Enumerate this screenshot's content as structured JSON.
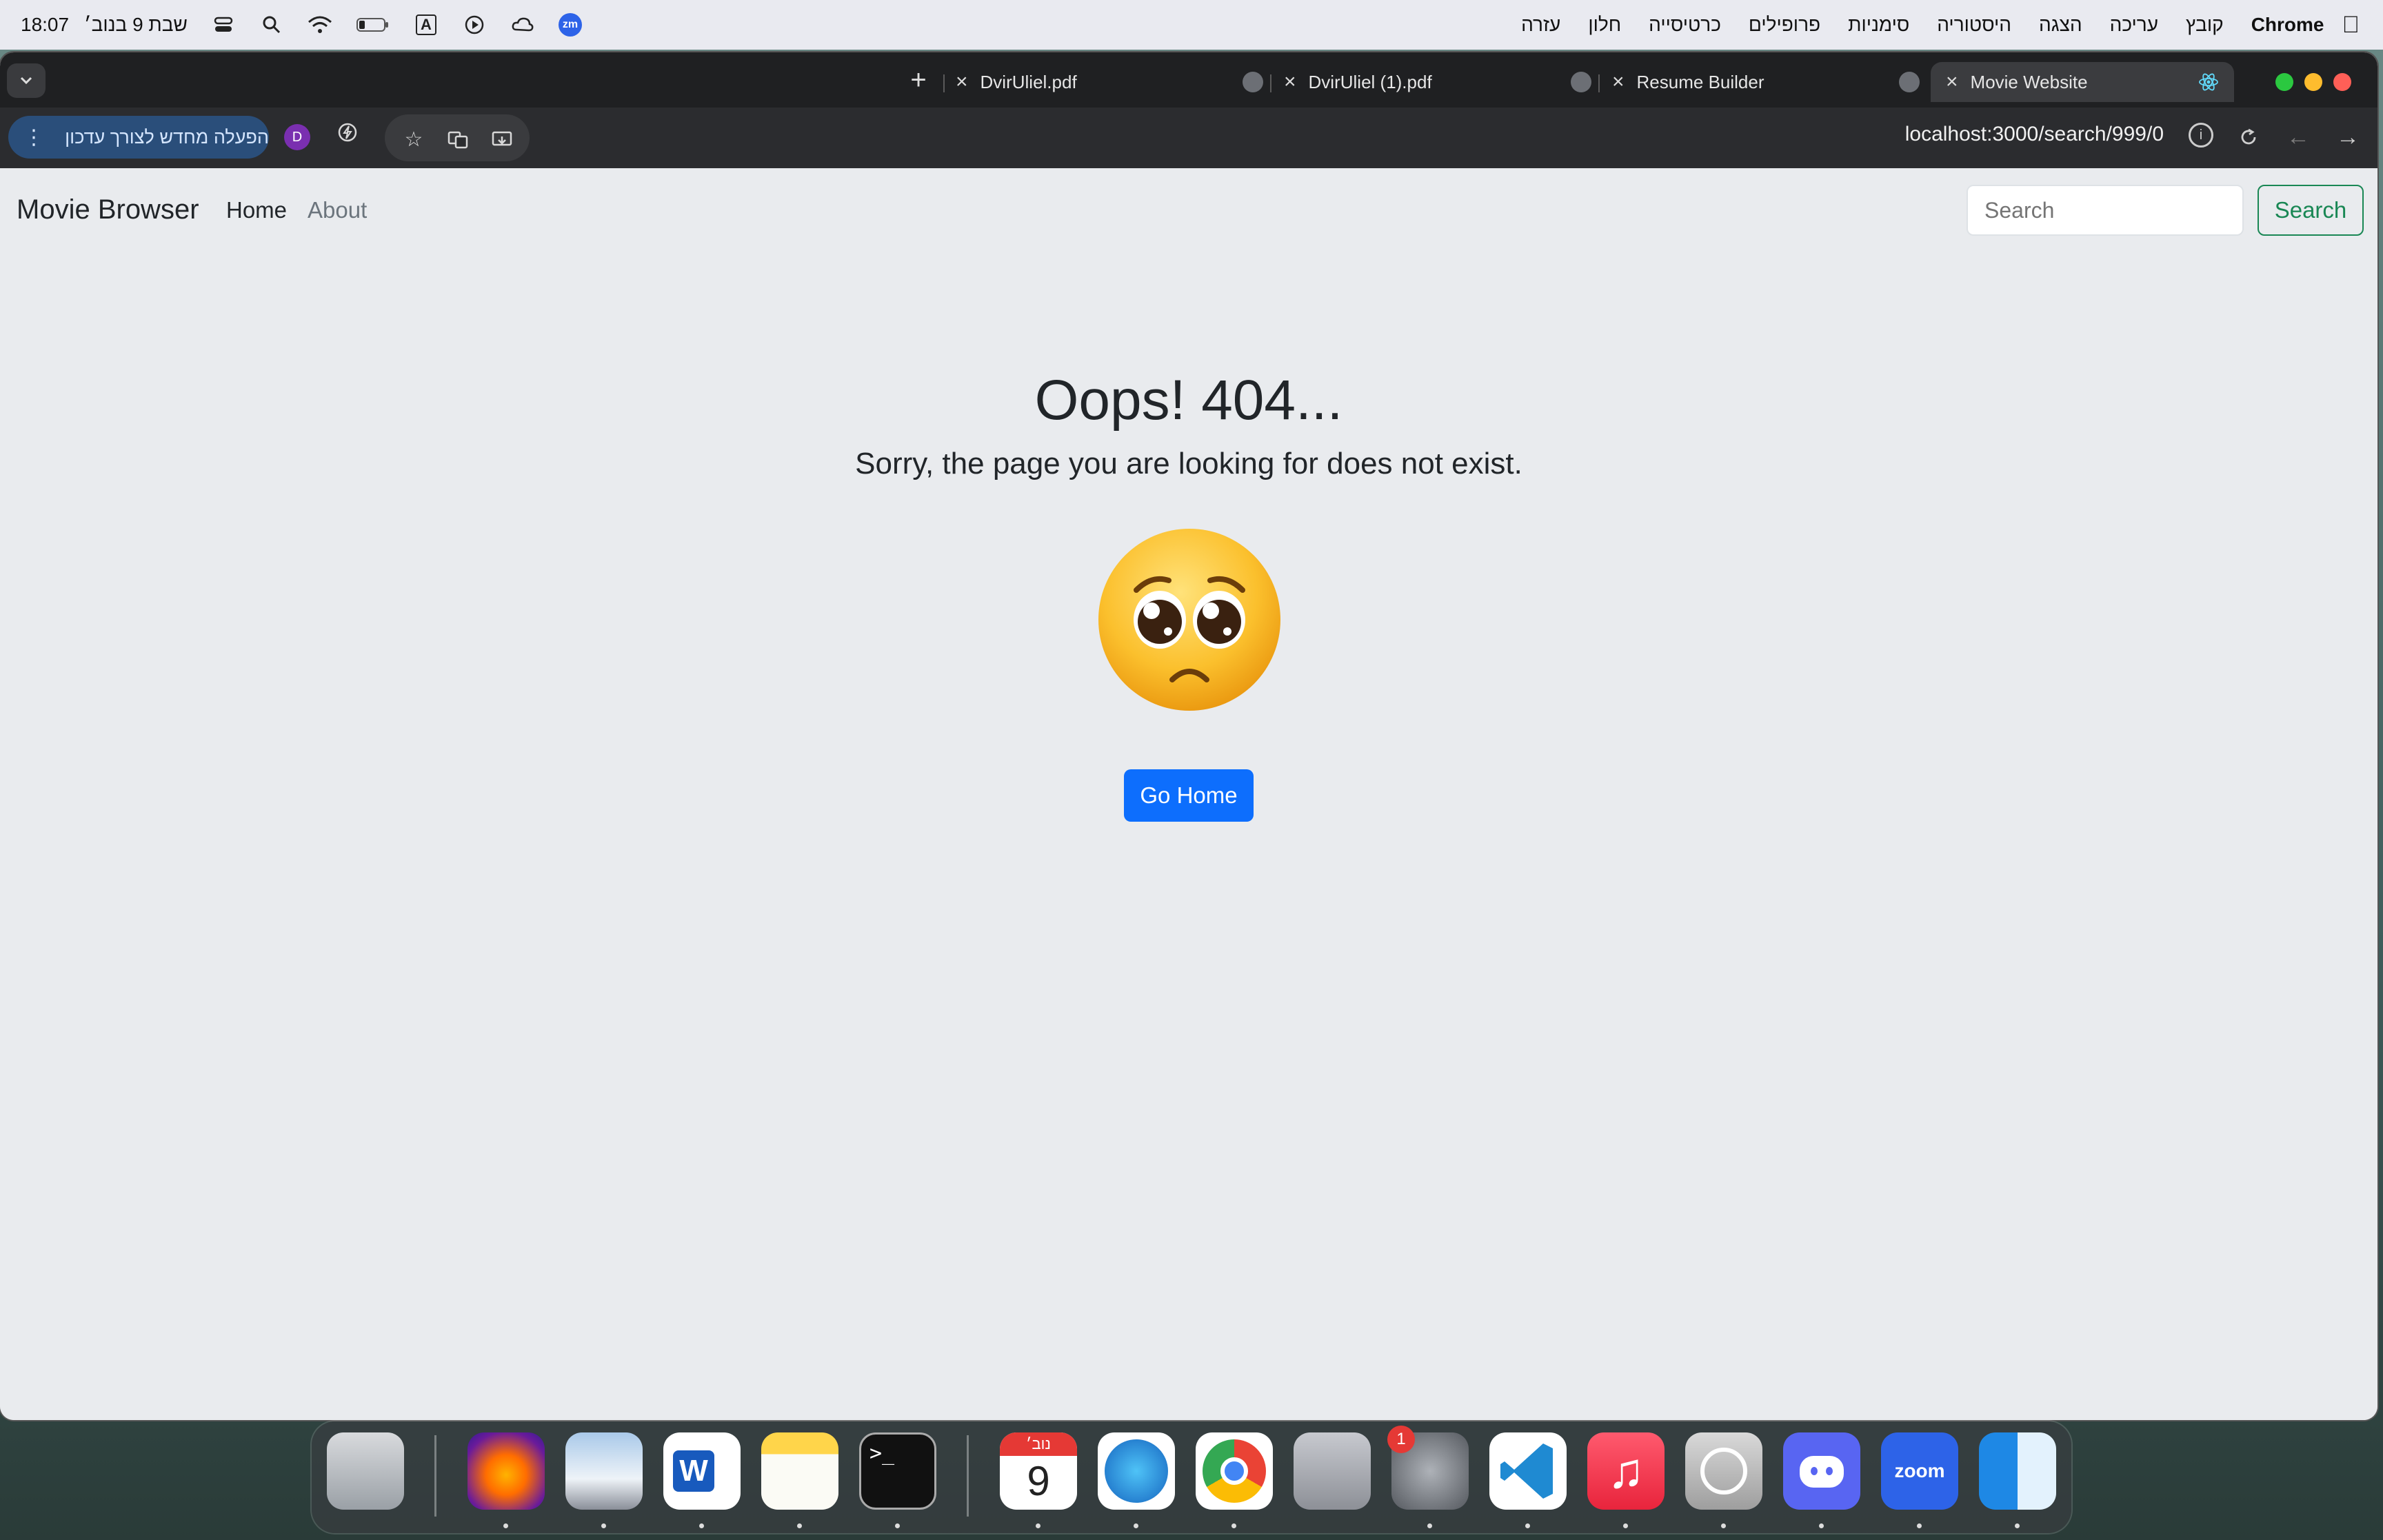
{
  "menubar": {
    "app_name": "Chrome",
    "items": [
      "קובץ",
      "עריכה",
      "הצגה",
      "היסטוריה",
      "סימניות",
      "פרופילים",
      "כרטיסייה",
      "חלון",
      "עזרה"
    ],
    "clock": "18:07",
    "date": "שבת 9 בנוב׳",
    "input_source": "A",
    "zoom_badge": "zm"
  },
  "tabs": [
    {
      "title": "Movie Website",
      "active": true
    },
    {
      "title": "Resume Builder",
      "active": false
    },
    {
      "title": "DvirUliel (1).pdf",
      "active": false
    },
    {
      "title": "DvirUliel.pdf",
      "active": false
    }
  ],
  "toolbar": {
    "url": "localhost:3000/search/999/0",
    "profile_initial": "D",
    "relaunch_label": "הפעלה מחדש לצורך עדכון"
  },
  "page": {
    "brand": "Movie Browser",
    "nav": {
      "home": "Home",
      "about": "About"
    },
    "search_placeholder": "Search",
    "search_button": "Search",
    "title": "Oops! 404...",
    "subtitle": "Sorry, the page you are looking for does not exist.",
    "go_home": "Go Home"
  },
  "dock": {
    "calendar_month": "נוב׳",
    "calendar_day": "9",
    "settings_badge": "1",
    "zoom_label": "zoom",
    "apps": [
      "trash",
      "firefox",
      "preview",
      "word",
      "notes",
      "terminal",
      "calendar",
      "safari",
      "chrome",
      "launchpad",
      "system-settings",
      "vscode",
      "music",
      "whatsapp",
      "discord",
      "zoom",
      "finder"
    ]
  },
  "colors": {
    "accent_primary": "#0d6efd",
    "success": "#198754",
    "badge_red": "#e53935"
  }
}
